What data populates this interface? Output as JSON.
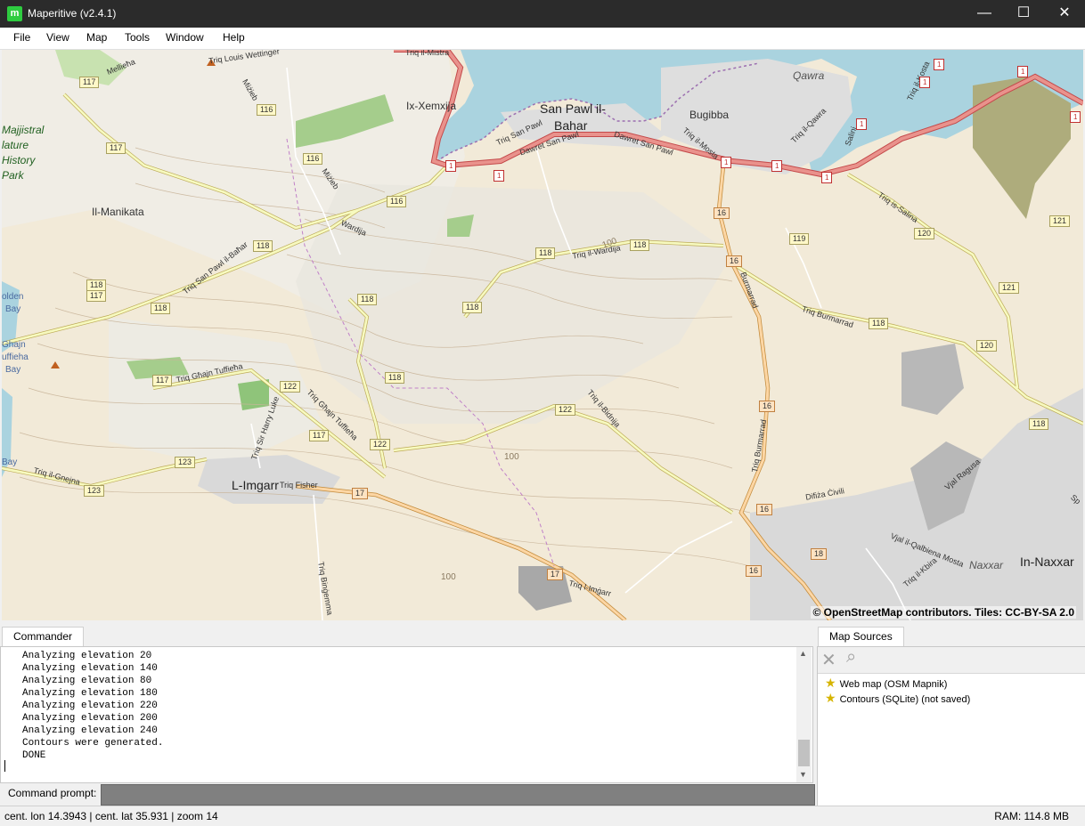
{
  "window": {
    "title": "Maperitive (v2.4.1)",
    "app_icon_letter": "m",
    "minimize": "—",
    "maximize": "☐",
    "close": "✕"
  },
  "menu": [
    "File",
    "View",
    "Map",
    "Tools",
    "Window",
    "Help"
  ],
  "map": {
    "attribution": "© OpenStreetMap contributors. Tiles: CC-BY-SA 2.0",
    "places": {
      "xemxija": "Ix-Xemxija",
      "san_pawl_1": "San Pawl il-",
      "san_pawl_2": "Bahar",
      "bugibba": "Bugibba",
      "qawra": "Qawra",
      "manikata": "Il-Manikata",
      "imgarr": "L-Imgarr",
      "naxxar_it": "Naxxar",
      "naxxar": "In-Naxxar",
      "park1": "Majjistral",
      "park2": "lature",
      "park3": "History",
      "park4": "Park",
      "golden_bay1": "olden",
      "golden_bay2": "Bay",
      "ghajn1": "Ghajn",
      "ghajn2": "uffieha",
      "ghajn3": "Bay",
      "bay_edge": "Bay"
    },
    "roads": {
      "wettinger": "Triq Louis Wettinger",
      "mistra": "Triq il-Mistra",
      "mellieha": "Mellieħa",
      "mizieb1": "Miżieb",
      "mizieb2": "Miżieb",
      "triq_san_pawl": "Triq San Pawl",
      "dawret1": "Dawret San Pawl",
      "dawret2": "Dawret San Pawl",
      "mosta": "Triq il-Mosta",
      "qawra_rd": "Triq il-Qawra",
      "kosta": "Triq il-Kosta",
      "salini": "Salini",
      "is_salina": "Triq is-Salina",
      "wardija": "Wardija",
      "triq_wardija": "Triq il-Wardija",
      "san_pawl_bahar": "Triq San Pawl il-Baħar",
      "burmarrad": "Burmarrad",
      "triq_burmarrad": "Triq Burmarrad",
      "ghajn_tuffieha": "Triq Għajn Tuffieħa",
      "sir_harry": "Triq Sir Harry Luke",
      "ghajn_tuffieha2": "Triq Għajn Tuffieħa",
      "bidnija": "Triq il-Bidnija",
      "triq_burmarrad2": "Triq Burmarrad",
      "gnejna": "Triq il-Gnejna",
      "fisher": "Triq Fisher",
      "bingemma": "Triq Binġemma",
      "imgarr_rd": "Triq l-Imġarr",
      "difiza": "Difiża Ċivili",
      "ragusa": "Vjal Ragusa",
      "qalbiena": "Vjal il-Qalbiena Mosta",
      "kbira": "Triq il-Kbira",
      "spain": "Sp",
      "wardija2": "Wardija"
    },
    "shields": {
      "s117a": "117",
      "s116a": "116",
      "s116b": "116",
      "s116c": "116",
      "s117b": "117",
      "s118a": "118",
      "s118b": "118",
      "s118c": "118",
      "s118d": "118",
      "s118e": "118",
      "s118f": "118",
      "s118g": "118",
      "s117c": "117",
      "s117d": "117",
      "s122a": "122",
      "s122b": "122",
      "s122c": "122",
      "s123a": "123",
      "s123b": "123",
      "s119": "119",
      "s120a": "120",
      "s120b": "120",
      "s121a": "121",
      "s121b": "121",
      "s118h": "118",
      "s118i": "118",
      "s118j": "118",
      "s16a": "16",
      "s16b": "16",
      "s16c": "16",
      "s16d": "16",
      "s16e": "16",
      "s17a": "17",
      "s17b": "17",
      "s18": "18",
      "s1a": "1",
      "s1b": "1",
      "s1c": "1",
      "s1d": "1",
      "s1e": "1",
      "s1f": "1",
      "s1g": "1",
      "s1h": "1",
      "s1i": "1",
      "s1j": "1"
    },
    "contours": {
      "c100a": "100",
      "c100b": "100",
      "c100c": "100"
    }
  },
  "commander": {
    "tab": "Commander",
    "log": [
      "Analyzing elevation 20",
      "Analyzing elevation 140",
      "Analyzing elevation 80",
      "Analyzing elevation 180",
      "Analyzing elevation 220",
      "Analyzing elevation 200",
      "Analyzing elevation 240",
      "Contours were generated.",
      "DONE"
    ],
    "prompt_label": "Command prompt:",
    "prompt_value": "",
    "scroll_up": "▲",
    "scroll_down": "▼"
  },
  "map_sources": {
    "tab": "Map Sources",
    "remove_icon": "✕",
    "zoom_icon": "⌕",
    "items": [
      "Web map (OSM Mapnik)",
      "Contours (SQLite) (not saved)"
    ],
    "star": "★"
  },
  "status": {
    "position": "cent. lon 14.3943 | cent. lat 35.931 | zoom 14",
    "ram": "RAM: 114.8 MB"
  }
}
